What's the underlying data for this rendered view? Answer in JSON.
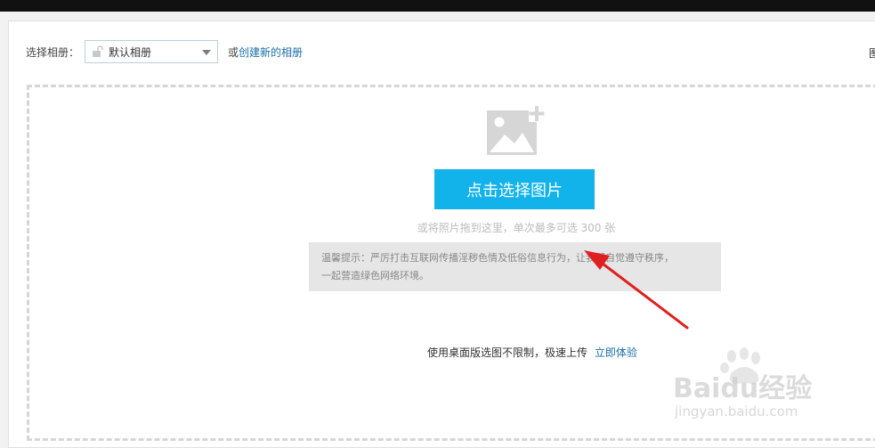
{
  "album": {
    "label": "选择相册：",
    "selected": "默认相册",
    "or_text": "或",
    "create_link": "创建新的相册"
  },
  "edge_text": "图",
  "upload": {
    "button_label": "点击选择图片",
    "drag_hint": "或将照片拖到这里，单次最多可选 300 张",
    "tip_line1": "温馨提示：严厉打击互联网传播淫秽色情及低俗信息行为，让我们自觉遵守秩序，",
    "tip_line2": "一起营造绿色网络环境。"
  },
  "desktop": {
    "text": "使用桌面版选图不限制，极速上传",
    "link": "立即体验"
  },
  "watermark": {
    "brand": "Baidu经验",
    "url": "jingyan.baidu.com"
  },
  "colors": {
    "button": "#12b3ea",
    "arrow": "#e02020",
    "link": "#1a6ea8"
  }
}
